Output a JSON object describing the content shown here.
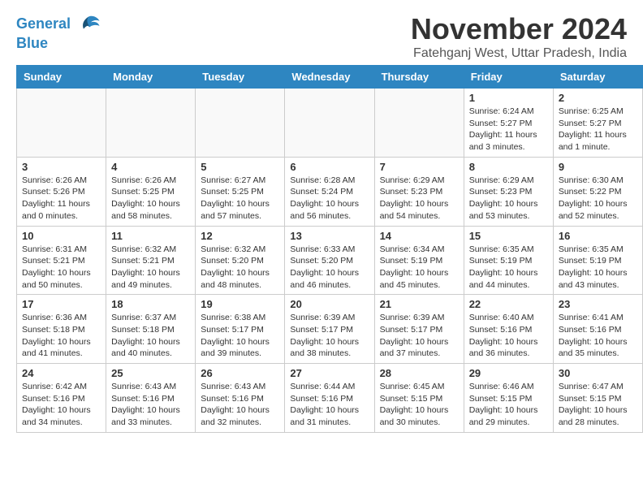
{
  "logo": {
    "line1": "General",
    "line2": "Blue"
  },
  "title": "November 2024",
  "location": "Fatehganj West, Uttar Pradesh, India",
  "weekdays": [
    "Sunday",
    "Monday",
    "Tuesday",
    "Wednesday",
    "Thursday",
    "Friday",
    "Saturday"
  ],
  "weeks": [
    [
      {
        "day": "",
        "info": ""
      },
      {
        "day": "",
        "info": ""
      },
      {
        "day": "",
        "info": ""
      },
      {
        "day": "",
        "info": ""
      },
      {
        "day": "",
        "info": ""
      },
      {
        "day": "1",
        "info": "Sunrise: 6:24 AM\nSunset: 5:27 PM\nDaylight: 11 hours\nand 3 minutes."
      },
      {
        "day": "2",
        "info": "Sunrise: 6:25 AM\nSunset: 5:27 PM\nDaylight: 11 hours\nand 1 minute."
      }
    ],
    [
      {
        "day": "3",
        "info": "Sunrise: 6:26 AM\nSunset: 5:26 PM\nDaylight: 11 hours\nand 0 minutes."
      },
      {
        "day": "4",
        "info": "Sunrise: 6:26 AM\nSunset: 5:25 PM\nDaylight: 10 hours\nand 58 minutes."
      },
      {
        "day": "5",
        "info": "Sunrise: 6:27 AM\nSunset: 5:25 PM\nDaylight: 10 hours\nand 57 minutes."
      },
      {
        "day": "6",
        "info": "Sunrise: 6:28 AM\nSunset: 5:24 PM\nDaylight: 10 hours\nand 56 minutes."
      },
      {
        "day": "7",
        "info": "Sunrise: 6:29 AM\nSunset: 5:23 PM\nDaylight: 10 hours\nand 54 minutes."
      },
      {
        "day": "8",
        "info": "Sunrise: 6:29 AM\nSunset: 5:23 PM\nDaylight: 10 hours\nand 53 minutes."
      },
      {
        "day": "9",
        "info": "Sunrise: 6:30 AM\nSunset: 5:22 PM\nDaylight: 10 hours\nand 52 minutes."
      }
    ],
    [
      {
        "day": "10",
        "info": "Sunrise: 6:31 AM\nSunset: 5:21 PM\nDaylight: 10 hours\nand 50 minutes."
      },
      {
        "day": "11",
        "info": "Sunrise: 6:32 AM\nSunset: 5:21 PM\nDaylight: 10 hours\nand 49 minutes."
      },
      {
        "day": "12",
        "info": "Sunrise: 6:32 AM\nSunset: 5:20 PM\nDaylight: 10 hours\nand 48 minutes."
      },
      {
        "day": "13",
        "info": "Sunrise: 6:33 AM\nSunset: 5:20 PM\nDaylight: 10 hours\nand 46 minutes."
      },
      {
        "day": "14",
        "info": "Sunrise: 6:34 AM\nSunset: 5:19 PM\nDaylight: 10 hours\nand 45 minutes."
      },
      {
        "day": "15",
        "info": "Sunrise: 6:35 AM\nSunset: 5:19 PM\nDaylight: 10 hours\nand 44 minutes."
      },
      {
        "day": "16",
        "info": "Sunrise: 6:35 AM\nSunset: 5:19 PM\nDaylight: 10 hours\nand 43 minutes."
      }
    ],
    [
      {
        "day": "17",
        "info": "Sunrise: 6:36 AM\nSunset: 5:18 PM\nDaylight: 10 hours\nand 41 minutes."
      },
      {
        "day": "18",
        "info": "Sunrise: 6:37 AM\nSunset: 5:18 PM\nDaylight: 10 hours\nand 40 minutes."
      },
      {
        "day": "19",
        "info": "Sunrise: 6:38 AM\nSunset: 5:17 PM\nDaylight: 10 hours\nand 39 minutes."
      },
      {
        "day": "20",
        "info": "Sunrise: 6:39 AM\nSunset: 5:17 PM\nDaylight: 10 hours\nand 38 minutes."
      },
      {
        "day": "21",
        "info": "Sunrise: 6:39 AM\nSunset: 5:17 PM\nDaylight: 10 hours\nand 37 minutes."
      },
      {
        "day": "22",
        "info": "Sunrise: 6:40 AM\nSunset: 5:16 PM\nDaylight: 10 hours\nand 36 minutes."
      },
      {
        "day": "23",
        "info": "Sunrise: 6:41 AM\nSunset: 5:16 PM\nDaylight: 10 hours\nand 35 minutes."
      }
    ],
    [
      {
        "day": "24",
        "info": "Sunrise: 6:42 AM\nSunset: 5:16 PM\nDaylight: 10 hours\nand 34 minutes."
      },
      {
        "day": "25",
        "info": "Sunrise: 6:43 AM\nSunset: 5:16 PM\nDaylight: 10 hours\nand 33 minutes."
      },
      {
        "day": "26",
        "info": "Sunrise: 6:43 AM\nSunset: 5:16 PM\nDaylight: 10 hours\nand 32 minutes."
      },
      {
        "day": "27",
        "info": "Sunrise: 6:44 AM\nSunset: 5:16 PM\nDaylight: 10 hours\nand 31 minutes."
      },
      {
        "day": "28",
        "info": "Sunrise: 6:45 AM\nSunset: 5:15 PM\nDaylight: 10 hours\nand 30 minutes."
      },
      {
        "day": "29",
        "info": "Sunrise: 6:46 AM\nSunset: 5:15 PM\nDaylight: 10 hours\nand 29 minutes."
      },
      {
        "day": "30",
        "info": "Sunrise: 6:47 AM\nSunset: 5:15 PM\nDaylight: 10 hours\nand 28 minutes."
      }
    ]
  ]
}
